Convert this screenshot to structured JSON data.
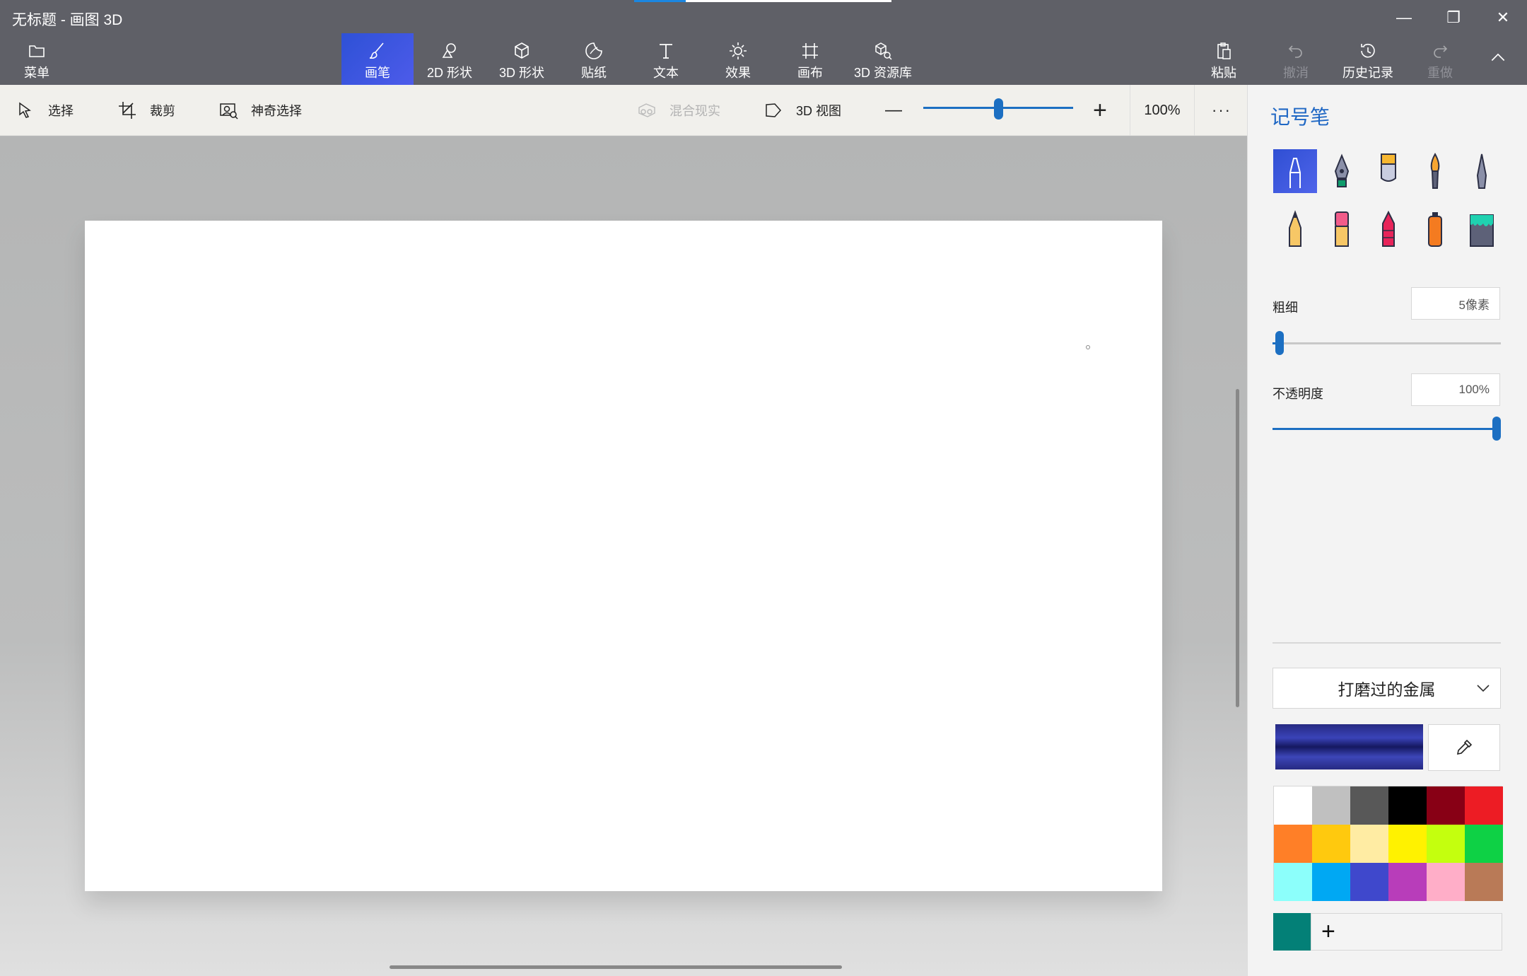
{
  "window": {
    "title": "无标题 - 画图 3D",
    "load_progress": 0.2,
    "controls": {
      "minimize": "—",
      "restore": "❐",
      "close": "✕"
    }
  },
  "ribbon": {
    "menu_label": "菜单",
    "tools": [
      {
        "label": "画笔",
        "icon": "brush-icon",
        "active": true
      },
      {
        "label": "2D 形状",
        "icon": "2d-shapes-icon"
      },
      {
        "label": "3D 形状",
        "icon": "3d-shapes-icon"
      },
      {
        "label": "贴纸",
        "icon": "stickers-icon"
      },
      {
        "label": "文本",
        "icon": "text-icon"
      },
      {
        "label": "效果",
        "icon": "effects-icon"
      },
      {
        "label": "画布",
        "icon": "canvas-icon"
      },
      {
        "label": "3D 资源库",
        "icon": "3d-library-icon"
      }
    ],
    "right_tools": [
      {
        "label": "粘贴",
        "icon": "paste-icon"
      },
      {
        "label": "撤消",
        "icon": "undo-icon",
        "disabled": true
      },
      {
        "label": "历史记录",
        "icon": "history-icon"
      },
      {
        "label": "重做",
        "icon": "redo-icon",
        "disabled": true
      }
    ],
    "collapse_icon": "chevron-up-icon"
  },
  "subbar": {
    "select_label": "选择",
    "crop_label": "裁剪",
    "magic_select_label": "神奇选择",
    "mixed_reality_label": "混合现实",
    "view3d_label": "3D 视图",
    "zoom_out": "—",
    "zoom_in": "+",
    "zoom_value": "100%",
    "zoom_fraction": 0.5,
    "more": "···"
  },
  "panel": {
    "title": "记号笔",
    "brushes": [
      {
        "name": "marker",
        "icon": "marker-icon",
        "active": true
      },
      {
        "name": "calligraphy-pen",
        "icon": "calligraphy-pen-icon"
      },
      {
        "name": "oil-brush",
        "icon": "oil-brush-icon"
      },
      {
        "name": "watercolor",
        "icon": "watercolor-icon"
      },
      {
        "name": "pixel-pen",
        "icon": "pixel-pen-icon"
      },
      {
        "name": "pencil",
        "icon": "pencil-icon"
      },
      {
        "name": "eraser",
        "icon": "eraser-icon"
      },
      {
        "name": "crayon",
        "icon": "crayon-icon"
      },
      {
        "name": "spray-can",
        "icon": "spray-can-icon"
      },
      {
        "name": "fill-bucket",
        "icon": "fill-icon"
      }
    ],
    "thickness_label": "粗细",
    "thickness_value": "5像素",
    "thickness_fraction": 0.03,
    "opacity_label": "不透明度",
    "opacity_value": "100%",
    "opacity_fraction": 1.0,
    "material_label": "打磨过的金属",
    "add_color": "+",
    "custom_color": "#038077",
    "accent": "#1c6fc2",
    "palette": [
      "#ffffff",
      "#c0c0c0",
      "#585858",
      "#000000",
      "#880015",
      "#ed1c24",
      "#ff7f27",
      "#ffc90e",
      "#ffeca3",
      "#fff200",
      "#c4ff0e",
      "#0ed145",
      "#8cfffb",
      "#00a8f3",
      "#3f48cc",
      "#b83dba",
      "#ffaec8",
      "#b97a57"
    ]
  }
}
